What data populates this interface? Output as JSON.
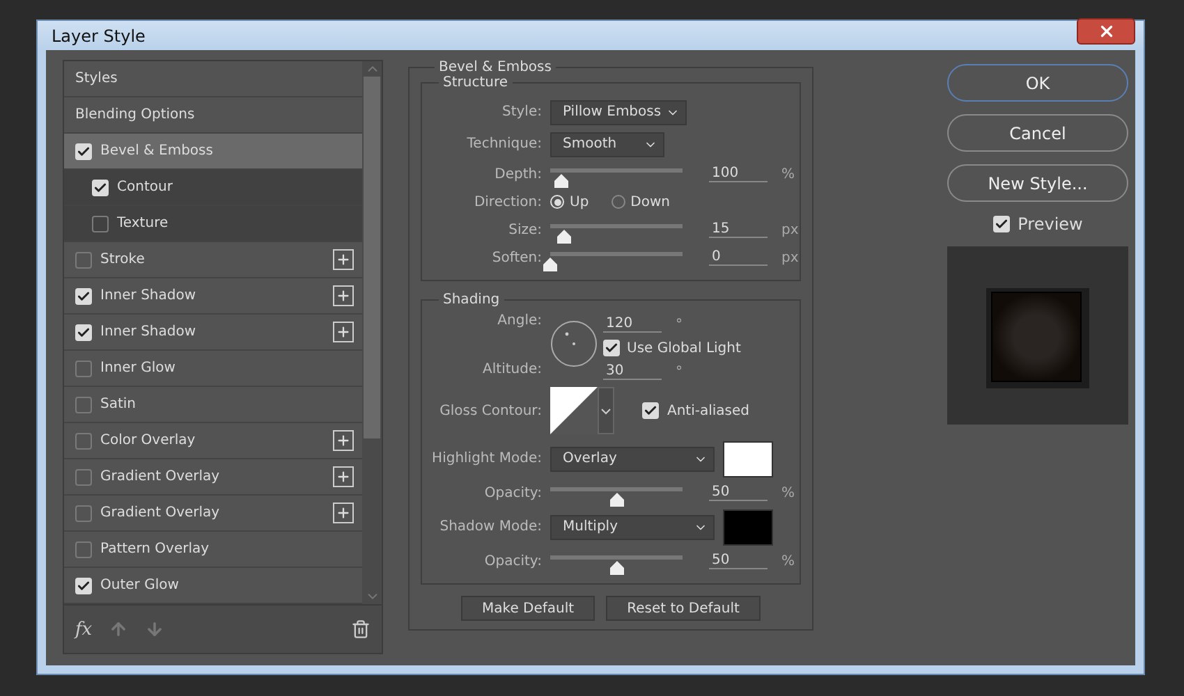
{
  "window": {
    "title": "Layer Style"
  },
  "styles_list": {
    "items": [
      {
        "kind": "header",
        "label": "Styles",
        "selected": false
      },
      {
        "kind": "header",
        "label": "Blending Options",
        "selected": false
      },
      {
        "kind": "effect",
        "label": "Bevel & Emboss",
        "checked": true,
        "selected": true,
        "addable": false,
        "children": [
          {
            "kind": "effect",
            "label": "Contour",
            "checked": true,
            "selected": false,
            "addable": false
          },
          {
            "kind": "effect",
            "label": "Texture",
            "checked": false,
            "selected": false,
            "addable": false
          }
        ]
      },
      {
        "kind": "effect",
        "label": "Stroke",
        "checked": false,
        "selected": false,
        "addable": true
      },
      {
        "kind": "effect",
        "label": "Inner Shadow",
        "checked": true,
        "selected": false,
        "addable": true
      },
      {
        "kind": "effect",
        "label": "Inner Shadow",
        "checked": true,
        "selected": false,
        "addable": true
      },
      {
        "kind": "effect",
        "label": "Inner Glow",
        "checked": false,
        "selected": false,
        "addable": false
      },
      {
        "kind": "effect",
        "label": "Satin",
        "checked": false,
        "selected": false,
        "addable": false
      },
      {
        "kind": "effect",
        "label": "Color Overlay",
        "checked": false,
        "selected": false,
        "addable": true
      },
      {
        "kind": "effect",
        "label": "Gradient Overlay",
        "checked": false,
        "selected": false,
        "addable": true
      },
      {
        "kind": "effect",
        "label": "Gradient Overlay",
        "checked": false,
        "selected": false,
        "addable": true
      },
      {
        "kind": "effect",
        "label": "Pattern Overlay",
        "checked": false,
        "selected": false,
        "addable": false
      },
      {
        "kind": "effect",
        "label": "Outer Glow",
        "checked": true,
        "selected": false,
        "addable": false
      }
    ],
    "fx_label": "fx"
  },
  "bevel_emboss": {
    "title": "Bevel & Emboss",
    "structure": {
      "title": "Structure",
      "style": {
        "label": "Style:",
        "value": "Pillow Emboss"
      },
      "technique": {
        "label": "Technique:",
        "value": "Smooth"
      },
      "depth": {
        "label": "Depth:",
        "level": 0.08,
        "value": "100",
        "unit": "%"
      },
      "direction": {
        "label": "Direction:",
        "options": [
          {
            "label": "Up",
            "selected": true
          },
          {
            "label": "Down",
            "selected": false
          }
        ]
      },
      "size": {
        "label": "Size:",
        "level": 0.1,
        "value": "15",
        "unit": "px"
      },
      "soften": {
        "label": "Soften:",
        "level": 0,
        "value": "0",
        "unit": "px"
      }
    },
    "shading": {
      "title": "Shading",
      "angle": {
        "label": "Angle:",
        "value": "120",
        "unit": "°"
      },
      "global_light": {
        "label": "Use Global Light",
        "checked": true
      },
      "altitude": {
        "label": "Altitude:",
        "value": "30",
        "unit": "°"
      },
      "gloss_contour": {
        "label": "Gloss Contour:"
      },
      "anti_aliased": {
        "label": "Anti-aliased",
        "checked": true
      },
      "highlight_mode": {
        "label": "Highlight Mode:",
        "value": "Overlay",
        "color": "#ffffff"
      },
      "highlight_opacity": {
        "label": "Opacity:",
        "level": 0.5,
        "value": "50",
        "unit": "%"
      },
      "shadow_mode": {
        "label": "Shadow Mode:",
        "value": "Multiply",
        "color": "#000000"
      },
      "shadow_opacity": {
        "label": "Opacity:",
        "level": 0.5,
        "value": "50",
        "unit": "%"
      }
    },
    "buttons": [
      {
        "label": "Make Default"
      },
      {
        "label": "Reset to Default"
      }
    ]
  },
  "actions": [
    {
      "label": "OK",
      "default": true
    },
    {
      "label": "Cancel",
      "default": false
    },
    {
      "label": "New Style...",
      "default": false
    }
  ],
  "preview": {
    "label": "Preview",
    "checked": true
  }
}
